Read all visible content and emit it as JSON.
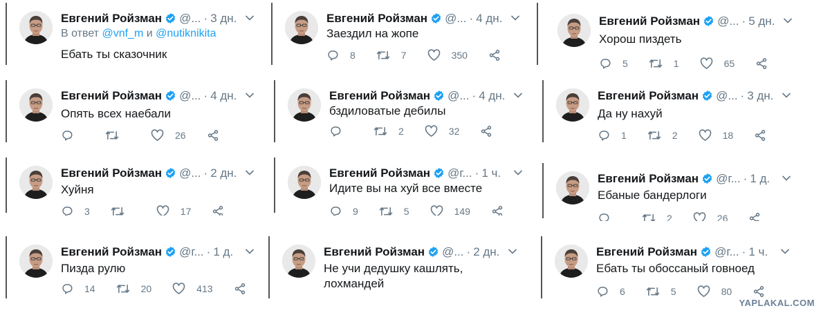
{
  "account": {
    "name": "Евгений Ройзман"
  },
  "tweets": [
    {
      "handle": "@...",
      "dot": "·",
      "time": "3 дн.",
      "reply_prefix": "В ответ",
      "reply_user1": "@vnf_m",
      "reply_and": "и",
      "reply_user2": "@nutiknikita",
      "text": "Ебать ты сказочник"
    },
    {
      "handle": "@...",
      "dot": "·",
      "time": "4 дн.",
      "text": "Заездил на жопе",
      "replies": "8",
      "retweets": "7",
      "likes": "350"
    },
    {
      "handle": "@...",
      "dot": "·",
      "time": "5 дн.",
      "text": "Хорош пиздеть",
      "replies": "5",
      "retweets": "1",
      "likes": "65"
    },
    {
      "handle": "@...",
      "dot": "·",
      "time": "4 дн.",
      "text": "Опять всех наебали",
      "replies": "",
      "retweets": "",
      "likes": "26"
    },
    {
      "handle": "@...",
      "dot": "·",
      "time": "4 дн.",
      "text": "бздиловатые дебилы",
      "replies": "",
      "retweets": "2",
      "likes": "32"
    },
    {
      "handle": "@...",
      "dot": "·",
      "time": "3 дн.",
      "text": "Да ну нахуй",
      "replies": "1",
      "retweets": "2",
      "likes": "18"
    },
    {
      "handle": "@...",
      "dot": "·",
      "time": "2 дн.",
      "text": "Хуйня",
      "replies": "3",
      "retweets": "",
      "likes": "17"
    },
    {
      "handle": "@г...",
      "dot": "·",
      "time": "1 ч.",
      "text": "Идите вы на хуй все вместе",
      "replies": "9",
      "retweets": "5",
      "likes": "149"
    },
    {
      "handle": "@г...",
      "dot": "·",
      "time": "1 д.",
      "text": "Ебаные бандерлоги",
      "replies": "",
      "retweets": "2",
      "likes": "26"
    },
    {
      "handle": "@г...",
      "dot": "·",
      "time": "1 д.",
      "text": "Пизда рулю",
      "replies": "14",
      "retweets": "20",
      "likes": "413"
    },
    {
      "handle": "@...",
      "dot": "·",
      "time": "2 дн.",
      "text": "Не учи дедушку кашлять,",
      "text2": "лохмандей"
    },
    {
      "handle": "@г...",
      "dot": "·",
      "time": "1 ч.",
      "text": "Ебать ты обоссаный говноед",
      "replies": "6",
      "retweets": "5",
      "likes": "80"
    }
  ],
  "watermark": "YAPLAKAL.COM",
  "colors": {
    "verified": "#1da1f2",
    "name": "#14171a",
    "meta": "#657786",
    "link": "#1da1f2"
  },
  "icons": [
    "verified-badge-icon",
    "chevron-down-icon",
    "reply-icon",
    "retweet-icon",
    "like-icon",
    "share-icon"
  ]
}
